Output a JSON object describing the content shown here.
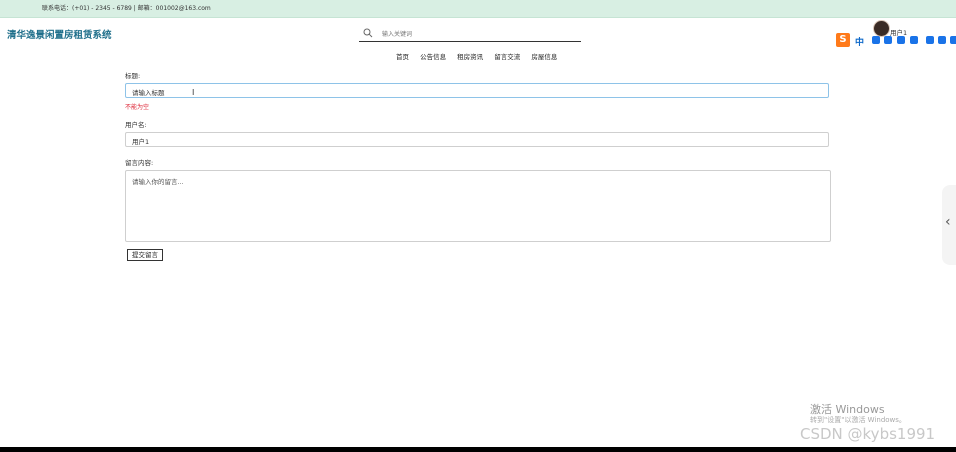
{
  "topbar": {
    "contact": "联系电话：(+01) - 2345 - 6789 | 邮箱：001002@163.com"
  },
  "site": {
    "title": "清华逸景闲置房租赁系统"
  },
  "search": {
    "placeholder": "输入关键词"
  },
  "nav": {
    "items": [
      "首页",
      "公告信息",
      "租房资讯",
      "留言交流",
      "房屋信息"
    ]
  },
  "user": {
    "name": "用户1"
  },
  "ime": {
    "zh": "中"
  },
  "form": {
    "title_label": "标题:",
    "title_value": "请输入标题",
    "title_error": "不能为空",
    "username_label": "用户名:",
    "username_value": "用户1",
    "content_label": "留言内容:",
    "content_placeholder": "请输入你的留言...",
    "submit_label": "提交留言"
  },
  "watermark": {
    "windows_line1": "激活 Windows",
    "windows_line2": "转到\"设置\"以激活 Windows。",
    "csdn": "CSDN @kybs1991"
  },
  "colors": {
    "topbar": "#d8efe3",
    "site_title": "#1f6f8b",
    "error": "#dd2233",
    "focus_border": "#8ec3e8"
  }
}
